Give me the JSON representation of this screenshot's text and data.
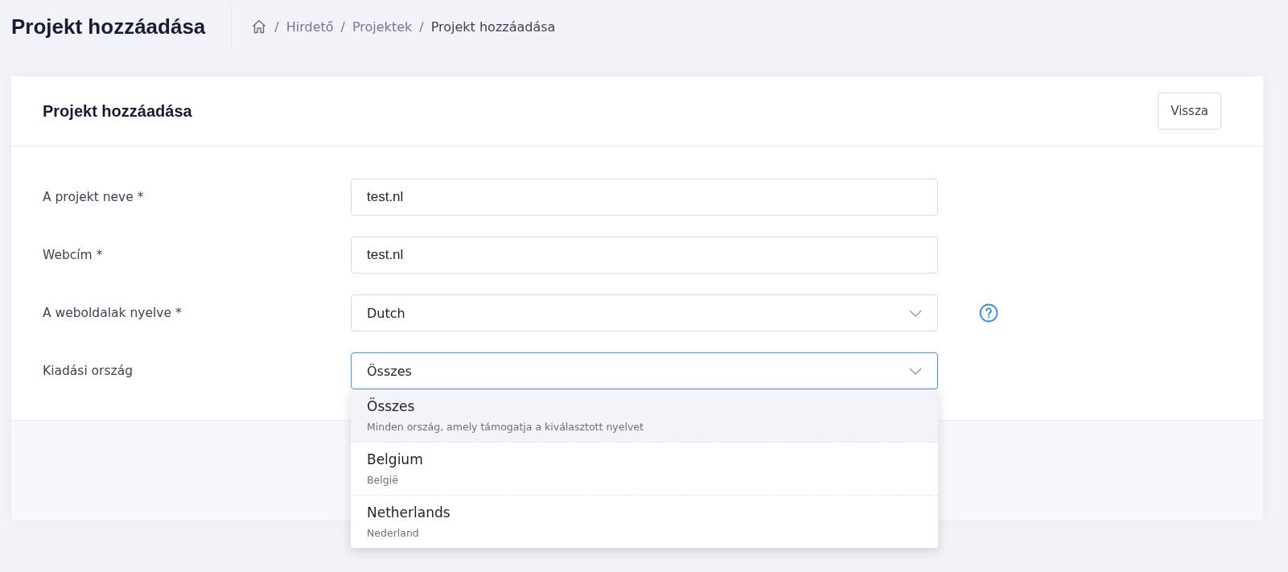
{
  "page_title": "Projekt hozzáadása",
  "breadcrumb": [
    {
      "label": "Hirdető",
      "current": false
    },
    {
      "label": "Projektek",
      "current": false
    },
    {
      "label": "Projekt hozzáadása",
      "current": true
    }
  ],
  "breadcrumb_separator": "/",
  "card": {
    "title": "Projekt hozzáadása",
    "back_button": "Vissza",
    "fields": [
      {
        "kind": "text",
        "label": "A projekt neve *",
        "value": "test.nl",
        "help": false
      },
      {
        "kind": "text",
        "label": "Webcím *",
        "value": "test.nl",
        "help": false
      },
      {
        "kind": "select",
        "label": "A weboldalak nyelve *",
        "value": "Dutch",
        "help": true,
        "open": false
      },
      {
        "kind": "select",
        "label": "Kiadási ország",
        "value": "Összes",
        "help": false,
        "open": true,
        "options": [
          {
            "label": "Összes",
            "description": "Minden ország, amely támogatja a kiválasztott nyelvet",
            "selected": true
          },
          {
            "label": "Belgium",
            "description": "België",
            "selected": false
          },
          {
            "label": "Netherlands",
            "description": "Nederland",
            "selected": false
          }
        ]
      }
    ]
  }
}
